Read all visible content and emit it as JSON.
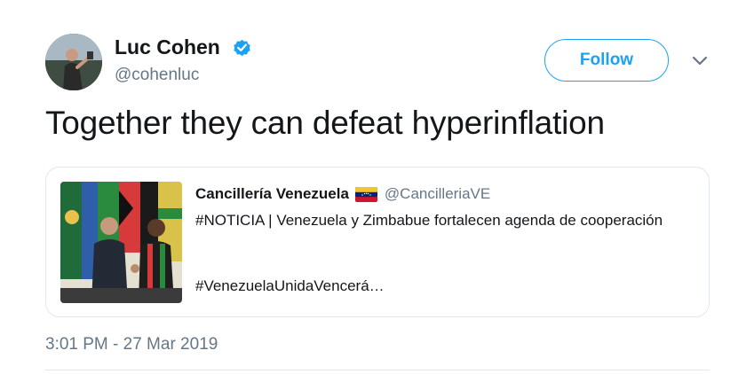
{
  "tweet": {
    "author": {
      "name": "Luc Cohen",
      "handle": "@cohenluc",
      "verified": true,
      "avatar_icon": "profile-photo"
    },
    "follow_label": "Follow",
    "more_icon": "chevron-down-icon",
    "text": "Together they can defeat hyperinflation",
    "timestamp": "3:01 PM - 27 Mar 2019"
  },
  "quoted": {
    "name": "Cancillería Venezuela",
    "flag_icon": "venezuela-flag",
    "handle": "@CancilleriaVE",
    "body": "#NOTICIA | Venezuela y Zimbabue fortalecen agenda de cooperación",
    "hashtag": "#VenezuelaUnidaVencerá…",
    "image_icon": "handshake-photo"
  },
  "colors": {
    "accent": "#1da1f2",
    "text": "#14171a",
    "secondary": "#657786",
    "border": "#e1e8ed"
  }
}
